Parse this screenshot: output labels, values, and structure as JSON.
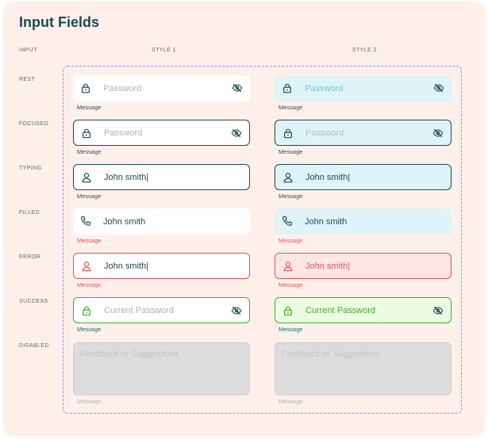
{
  "title": "Input Fields",
  "headers": {
    "input": "INPUT",
    "style1": "STYLE 1",
    "style2": "STYLE 2"
  },
  "rows": {
    "rest": {
      "label": "REST"
    },
    "focused": {
      "label": "FOCUSED"
    },
    "typing": {
      "label": "TYPING"
    },
    "filled": {
      "label": "FILLED"
    },
    "error": {
      "label": "ERROR"
    },
    "success": {
      "label": "SUCCESS"
    },
    "disabled": {
      "label": "DISABLED"
    }
  },
  "fields": {
    "rest": {
      "text": "Password",
      "message": "Message"
    },
    "focused": {
      "text": "Password",
      "message": "Message"
    },
    "typing": {
      "text": "John smith|",
      "message": "Message"
    },
    "filled": {
      "text": "John smith",
      "message": "Message"
    },
    "error": {
      "text": "John smith|",
      "message": "Message"
    },
    "success": {
      "text": "Current Password",
      "message": "Message"
    },
    "disabled": {
      "text": "Feedback or Suggestions",
      "message": "Message"
    }
  },
  "colors": {
    "teal_dark": "#1b4a52",
    "teal_light": "#dff4f8",
    "error": "#e0545a",
    "error_bg": "#fde5e5",
    "success": "#3bb324",
    "success_bg": "#ecfbe3",
    "frame": "#a57cf5"
  },
  "icons": {
    "lock": "lock-icon",
    "eye_off": "eye-off-icon",
    "user": "user-icon",
    "phone": "phone-icon"
  }
}
